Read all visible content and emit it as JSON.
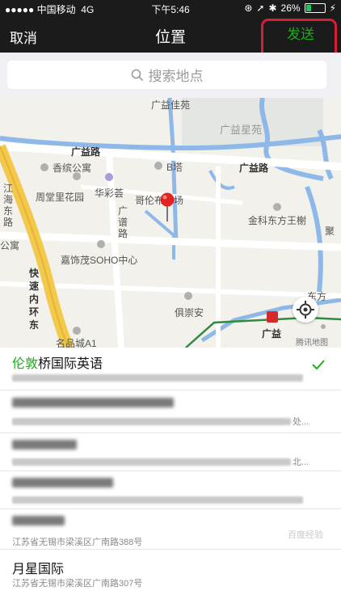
{
  "status": {
    "carrier": "中国移动",
    "network": "4G",
    "time": "下午5:46",
    "battery": "26%"
  },
  "nav": {
    "cancel": "取消",
    "title": "位置",
    "send": "发送"
  },
  "search": {
    "placeholder": "搜索地点"
  },
  "map": {
    "labels": {
      "guangyijiayuan": "广益佳苑",
      "guangyixingyuan": "广益星苑",
      "guangyilu1": "广益路",
      "guangyilu2": "广益路",
      "xiangbin": "香缤公寓",
      "btower": "B塔",
      "zhoutang": "周堂里花园",
      "huacai": "华彩荟",
      "gelun": "哥伦布广场",
      "jinke": "金科东方王榭",
      "jianghai": "江海东路",
      "gongyu": "公寓",
      "guangpu": "广谱路",
      "jiashi": "嘉饰茂SOHO中心",
      "kuaisu": "快速内环东",
      "chongan": "俱崇安",
      "dongfang": "东方",
      "mingpin": "名品城A1",
      "guangyi_station": "广益",
      "tencent": "腾讯地图",
      "ju": "聚"
    }
  },
  "results": [
    {
      "name_highlight": "伦敦",
      "name_rest": "桥国际英语",
      "address": ""
    },
    {
      "name_highlight": "",
      "name_rest": "",
      "address": "处..."
    },
    {
      "name_highlight": "",
      "name_rest": "",
      "address": "北..."
    },
    {
      "name_highlight": "",
      "name_rest": "",
      "address": ""
    },
    {
      "name_highlight": "",
      "name_rest": "",
      "address": "江苏省无锡市梁溪区广南路388号"
    },
    {
      "name_highlight": "",
      "name_rest": "月星国际",
      "address": "江苏省无锡市梁溪区广南路307号"
    }
  ],
  "watermark": "百度经验",
  "colors": {
    "accent_green": "#1aad19",
    "highlight_red": "#d81e34"
  }
}
